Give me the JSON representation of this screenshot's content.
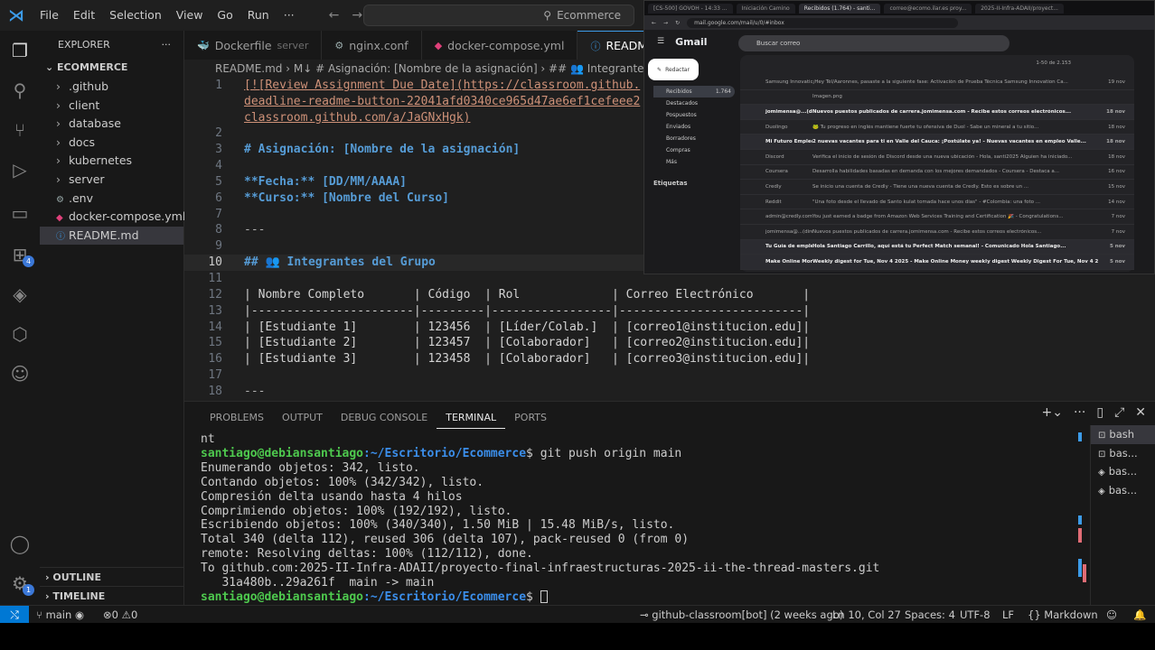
{
  "titlebar": {
    "logo": "⋊",
    "menu": [
      "File",
      "Edit",
      "Selection",
      "View",
      "Go",
      "Run",
      "···"
    ],
    "search_text": "Ecommerce"
  },
  "sidebar": {
    "header": "EXPLORER",
    "more": "···",
    "root": "ECOMMERCE",
    "items": [
      {
        "label": ".github",
        "type": "folder"
      },
      {
        "label": "client",
        "type": "folder"
      },
      {
        "label": "database",
        "type": "folder"
      },
      {
        "label": "docs",
        "type": "folder"
      },
      {
        "label": "kubernetes",
        "type": "folder"
      },
      {
        "label": "server",
        "type": "folder"
      },
      {
        "label": ".env",
        "type": "env"
      },
      {
        "label": "docker-compose.yml",
        "type": "yml"
      },
      {
        "label": "README.md",
        "type": "md"
      }
    ],
    "outline": "OUTLINE",
    "timeline": "TIMELINE"
  },
  "tabs": [
    {
      "label": "Dockerfile",
      "sub": "server",
      "icon": "whale-icon"
    },
    {
      "label": "nginx.conf",
      "sub": "",
      "icon": "gear-icon"
    },
    {
      "label": "docker-compose.yml",
      "sub": "",
      "icon": "yml-icon"
    },
    {
      "label": "README",
      "sub": "",
      "icon": "info-icon"
    }
  ],
  "breadcrumb": "README.md › M↓ # Asignación: [Nombre de la asignación] › ## 👥 Integrantes del",
  "editor": {
    "current_line": 10,
    "line_numbers": [
      "1",
      "",
      "",
      "2",
      "3",
      "4",
      "5",
      "6",
      "7",
      "8",
      "9",
      "10",
      "11",
      "12",
      "13",
      "14",
      "15",
      "16",
      "17",
      "18"
    ],
    "lines": [
      "[![Review Assignment Due Date](https://classroom.github.",
      "deadline-readme-button-22041afd0340ce965d47ae6ef1cefeee2",
      "classroom.github.com/a/JaGNxHgk)",
      "",
      "# Asignación: [Nombre de la asignación]",
      "",
      "**Fecha:** [DD/MM/AAAA]",
      "**Curso:** [Nombre del Curso]",
      "",
      "---",
      "",
      "## 👥 Integrantes del Grupo",
      "",
      "| Nombre Completo       | Código  | Rol             | Correo Electrónico       |",
      "|-----------------------|---------|-----------------|--------------------------|",
      "| [Estudiante 1]        | 123456  | [Líder/Colab.]  | [correo1@institucion.edu]|",
      "| [Estudiante 2]        | 123457  | [Colaborador]   | [correo2@institucion.edu]|",
      "| [Estudiante 3]        | 123458  | [Colaborador]   | [correo3@institucion.edu]|",
      "",
      "---"
    ]
  },
  "gmail": {
    "browser_tabs": [
      "[CS-500] GOVOH - 14:33 ...",
      "Iniciación Camino",
      "Recibidos (1.764) - santi...",
      "correo@ecomo.ilar.es proy...",
      "2025-II-Infra-ADAII/proyect..."
    ],
    "url": "mail.google.com/mail/u/0/#inbox",
    "logo": "Gmail",
    "search_placeholder": "Buscar correo",
    "compose": "Redactar",
    "nav": [
      {
        "label": "Recibidos",
        "count": "1.764"
      },
      {
        "label": "Destacados",
        "count": ""
      },
      {
        "label": "Pospuestos",
        "count": ""
      },
      {
        "label": "Enviados",
        "count": ""
      },
      {
        "label": "Borradores",
        "count": ""
      },
      {
        "label": "Compras",
        "count": ""
      },
      {
        "label": "Más",
        "count": ""
      }
    ],
    "labels_heading": "Etiquetas",
    "pager": "1-50 de 2.153",
    "rows": [
      {
        "sender": "Samsung Innovation",
        "subject": "¡Hey Tél/Aaronnes, pasaste a la siguiente fase: Activación de Prueba Técnica Samsung Innovation Ca...",
        "date": "19 nov",
        "unread": false
      },
      {
        "sender": "",
        "subject": "Imagen.png",
        "date": "",
        "unread": false
      },
      {
        "sender": "jomimensa@...(direct.",
        "subject": "Nuevos puestos publicados de carrera.jomimensa.com - Recibe estos correos electrónicos...",
        "date": "18 nov",
        "unread": true
      },
      {
        "sender": "Duolingo",
        "subject": "🐸 Tu progreso en inglés mantiene fuerte tu ofensiva de Duol - Sabe un mineral a tu sitio...",
        "date": "18 nov",
        "unread": false
      },
      {
        "sender": "Mi Futuro Empleo",
        "subject": "2 nuevas vacantes para ti en Valle del Cauca: ¡Postúlate ya! - Nuevas vacantes en empleo Valle...",
        "date": "18 nov",
        "unread": true
      },
      {
        "sender": "Discord",
        "subject": "Verifica el inicio de sesión de Discord desde una nueva ubicación - Hola, santi2025 Alguien ha iniciado...",
        "date": "18 nov",
        "unread": false
      },
      {
        "sender": "Coursera",
        "subject": "Desarrolla habilidades basadas en demanda con los mejores demandados - Coursera - Destaca a...",
        "date": "16 nov",
        "unread": false
      },
      {
        "sender": "Credly",
        "subject": "Se inicio una cuenta de Credly - Tiene una nueva cuenta de Credly. Esto es sobre un ...",
        "date": "15 nov",
        "unread": false
      },
      {
        "sender": "Reddit",
        "subject": "\"Una foto desde el llevado de Santo kulat tomada hace unos días\" - #Colombia: una foto ...",
        "date": "14 nov",
        "unread": false
      },
      {
        "sender": "admin@credly.com",
        "subject": "You just earned a badge from Amazon Web Services Training and Certification 🎉 - Congratulations...",
        "date": "7 nov",
        "unread": false
      },
      {
        "sender": "jomimensa@...(direct.",
        "subject": "Nuevos puestos publicados de carrera.jomimensa.com - Recibe estos correos electrónicos...",
        "date": "7 nov",
        "unread": false
      },
      {
        "sender": "Tu Guía de empleos.",
        "subject": "Hola Santiago Carrillo, aquí está tu Perfect Match semanal! - Comunicado Hola Santiago...",
        "date": "5 nov",
        "unread": true
      },
      {
        "sender": "Make Online Money...",
        "subject": "Weekly digest for Tue, Nov 4 2025 - Make Online Money weekly digest Weekly Digest For Tue, Nov 4 2...",
        "date": "5 nov",
        "unread": true
      }
    ]
  },
  "panel": {
    "tabs": [
      "PROBLEMS",
      "OUTPUT",
      "DEBUG CONSOLE",
      "TERMINAL",
      "PORTS"
    ],
    "active_tab": "TERMINAL",
    "terminal": {
      "first": "nt",
      "prompt_user": "santiago@debiansantiago",
      "prompt_path": ":~/Escritorio/Ecommerce",
      "prompt_suffix": "$ ",
      "command": "git push origin main",
      "output": [
        "Enumerando objetos: 342, listo.",
        "Contando objetos: 100% (342/342), listo.",
        "Compresión delta usando hasta 4 hilos",
        "Comprimiendo objetos: 100% (192/192), listo.",
        "Escribiendo objetos: 100% (340/340), 1.50 MiB | 15.48 MiB/s, listo.",
        "Total 340 (delta 112), reused 306 (delta 107), pack-reused 0 (from 0)",
        "remote: Resolving deltas: 100% (112/112), done.",
        "To github.com:2025-II-Infra-ADAII/proyecto-final-infraestructuras-2025-ii-the-thread-masters.git",
        "   31a480b..29a261f  main -> main"
      ]
    },
    "terminals": [
      "bash",
      "bas...",
      "bas...",
      "bas..."
    ]
  },
  "statusbar": {
    "branch": "main",
    "errors": "0",
    "warnings": "0",
    "blame": "github-classroom[bot] (2 weeks ago)",
    "position": "Ln 10, Col 27",
    "spaces": "Spaces: 4",
    "encoding": "UTF-8",
    "eol": "LF",
    "language": "Markdown"
  },
  "colors": {
    "accent": "#0078d4",
    "prompt_user": "#4ec94e",
    "prompt_path": "#3b8eea",
    "markdown_heading": "#569cd6",
    "markdown_string": "#ce9178"
  }
}
